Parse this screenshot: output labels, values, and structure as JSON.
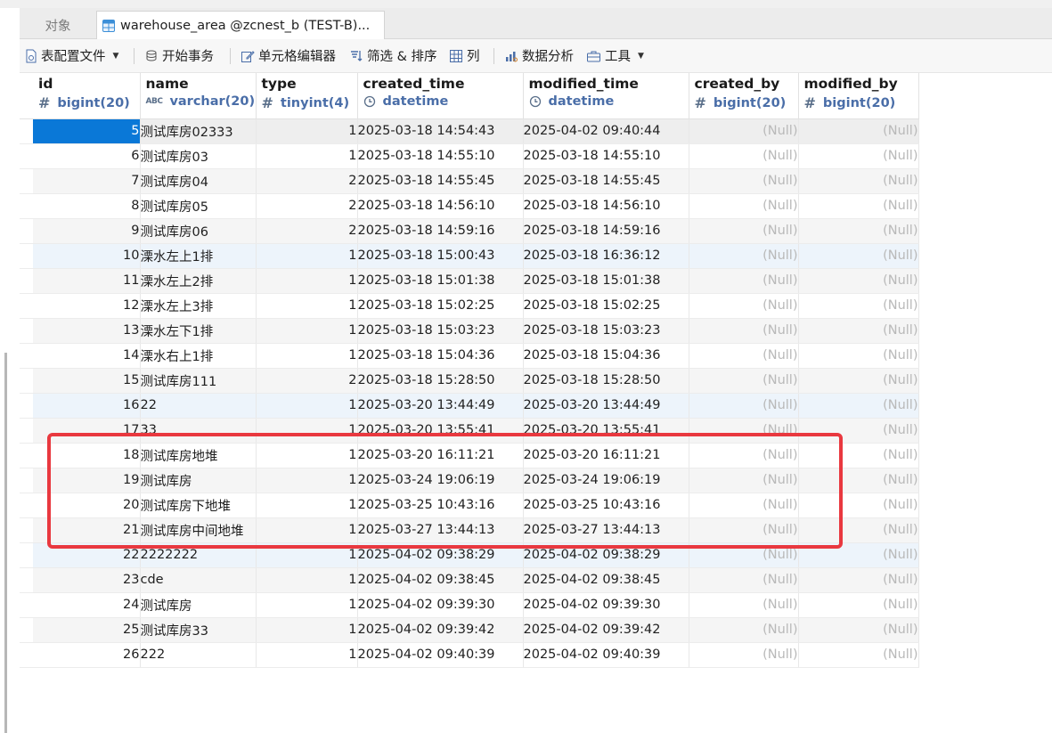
{
  "tabs": {
    "objects_label": "对象",
    "active_label": "warehouse_area @zcnest_b (TEST-B)..."
  },
  "toolbar": {
    "table_config": "表配置文件",
    "begin_tx": "开始事务",
    "cell_editor": "单元格编辑器",
    "filter_sort": "筛选 & 排序",
    "columns": "列",
    "data_analysis": "数据分析",
    "tools": "工具"
  },
  "grid": {
    "columns": [
      {
        "name": "id",
        "type": "bigint(20)",
        "type_icon": "#"
      },
      {
        "name": "name",
        "type": "varchar(20)",
        "type_icon": "ABC"
      },
      {
        "name": "type",
        "type": "tinyint(4)",
        "type_icon": "#"
      },
      {
        "name": "created_time",
        "type": "datetime",
        "type_icon": "clock"
      },
      {
        "name": "modified_time",
        "type": "datetime",
        "type_icon": "clock"
      },
      {
        "name": "created_by",
        "type": "bigint(20)",
        "type_icon": "#"
      },
      {
        "name": "modified_by",
        "type": "bigint(20)",
        "type_icon": "#"
      }
    ],
    "rows": [
      [
        "5",
        "测试库房02333",
        "1",
        "2025-03-18 14:54:43",
        "2025-04-02 09:40:44",
        "(Null)",
        "(Null)"
      ],
      [
        "6",
        "测试库房03",
        "1",
        "2025-03-18 14:55:10",
        "2025-03-18 14:55:10",
        "(Null)",
        "(Null)"
      ],
      [
        "7",
        "测试库房04",
        "2",
        "2025-03-18 14:55:45",
        "2025-03-18 14:55:45",
        "(Null)",
        "(Null)"
      ],
      [
        "8",
        "测试库房05",
        "2",
        "2025-03-18 14:56:10",
        "2025-03-18 14:56:10",
        "(Null)",
        "(Null)"
      ],
      [
        "9",
        "测试库房06",
        "2",
        "2025-03-18 14:59:16",
        "2025-03-18 14:59:16",
        "(Null)",
        "(Null)"
      ],
      [
        "10",
        "溧水左上1排",
        "1",
        "2025-03-18 15:00:43",
        "2025-03-18 16:36:12",
        "(Null)",
        "(Null)"
      ],
      [
        "11",
        "溧水左上2排",
        "1",
        "2025-03-18 15:01:38",
        "2025-03-18 15:01:38",
        "(Null)",
        "(Null)"
      ],
      [
        "12",
        "溧水左上3排",
        "1",
        "2025-03-18 15:02:25",
        "2025-03-18 15:02:25",
        "(Null)",
        "(Null)"
      ],
      [
        "13",
        "溧水左下1排",
        "1",
        "2025-03-18 15:03:23",
        "2025-03-18 15:03:23",
        "(Null)",
        "(Null)"
      ],
      [
        "14",
        "溧水右上1排",
        "1",
        "2025-03-18 15:04:36",
        "2025-03-18 15:04:36",
        "(Null)",
        "(Null)"
      ],
      [
        "15",
        "测试库房111",
        "2",
        "2025-03-18 15:28:50",
        "2025-03-18 15:28:50",
        "(Null)",
        "(Null)"
      ],
      [
        "16",
        "22",
        "1",
        "2025-03-20 13:44:49",
        "2025-03-20 13:44:49",
        "(Null)",
        "(Null)"
      ],
      [
        "17",
        "33",
        "1",
        "2025-03-20 13:55:41",
        "2025-03-20 13:55:41",
        "(Null)",
        "(Null)"
      ],
      [
        "18",
        "测试库房地堆",
        "1",
        "2025-03-20 16:11:21",
        "2025-03-20 16:11:21",
        "(Null)",
        "(Null)"
      ],
      [
        "19",
        "测试库房",
        "1",
        "2025-03-24 19:06:19",
        "2025-03-24 19:06:19",
        "(Null)",
        "(Null)"
      ],
      [
        "20",
        "测试库房下地堆",
        "1",
        "2025-03-25 10:43:16",
        "2025-03-25 10:43:16",
        "(Null)",
        "(Null)"
      ],
      [
        "21",
        "测试库房中间地堆",
        "1",
        "2025-03-27 13:44:13",
        "2025-03-27 13:44:13",
        "(Null)",
        "(Null)"
      ],
      [
        "22",
        "2222222",
        "1",
        "2025-04-02 09:38:29",
        "2025-04-02 09:38:29",
        "(Null)",
        "(Null)"
      ],
      [
        "23",
        "cde",
        "1",
        "2025-04-02 09:38:45",
        "2025-04-02 09:38:45",
        "(Null)",
        "(Null)"
      ],
      [
        "24",
        "测试库房",
        "1",
        "2025-04-02 09:39:30",
        "2025-04-02 09:39:30",
        "(Null)",
        "(Null)"
      ],
      [
        "25",
        "测试库房33",
        "1",
        "2025-04-02 09:39:42",
        "2025-04-02 09:39:42",
        "(Null)",
        "(Null)"
      ],
      [
        "26",
        "222",
        "1",
        "2025-04-02 09:40:39",
        "2025-04-02 09:40:39",
        "(Null)",
        "(Null)"
      ]
    ],
    "selected_row": 0,
    "highlighted_rows": [
      5,
      11,
      17
    ],
    "annotated_rows": [
      13,
      14,
      15,
      16
    ],
    "colors": {
      "selection": "#0a78d7",
      "annotation": "#e9383f",
      "null_text": "#b9b9b9",
      "type_text": "#4a6ea8"
    }
  }
}
